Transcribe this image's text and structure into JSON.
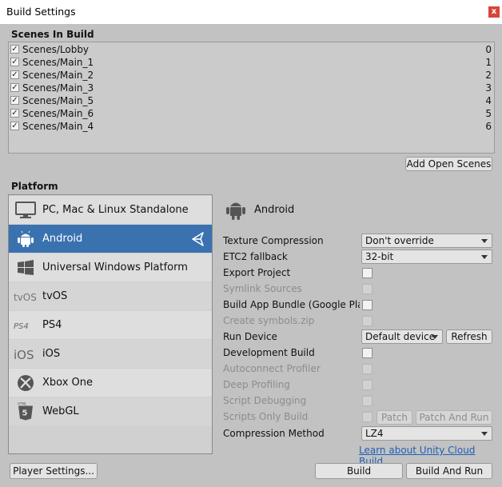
{
  "window": {
    "title": "Build Settings",
    "close_label": "x"
  },
  "scenes": {
    "header": "Scenes In Build",
    "items": [
      {
        "name": "Scenes/Lobby",
        "index": "0",
        "checked": true
      },
      {
        "name": "Scenes/Main_1",
        "index": "1",
        "checked": true
      },
      {
        "name": "Scenes/Main_2",
        "index": "2",
        "checked": true
      },
      {
        "name": "Scenes/Main_3",
        "index": "3",
        "checked": true
      },
      {
        "name": "Scenes/Main_5",
        "index": "4",
        "checked": true
      },
      {
        "name": "Scenes/Main_6",
        "index": "5",
        "checked": true
      },
      {
        "name": "Scenes/Main_4",
        "index": "6",
        "checked": true
      }
    ],
    "add_open_scenes": "Add Open Scenes"
  },
  "platform": {
    "header": "Platform",
    "items": [
      {
        "label": "PC, Mac & Linux Standalone",
        "icon": "monitor-icon"
      },
      {
        "label": "Android",
        "icon": "android-icon",
        "selected": true,
        "active_icon": "unity-logo-icon"
      },
      {
        "label": "Universal Windows Platform",
        "icon": "windows-icon"
      },
      {
        "label": "tvOS",
        "icon": "tvos-icon",
        "icon_text": "tvOS"
      },
      {
        "label": "PS4",
        "icon": "ps4-icon",
        "icon_text": "PS4"
      },
      {
        "label": "iOS",
        "icon": "ios-icon",
        "icon_text": "iOS"
      },
      {
        "label": "Xbox One",
        "icon": "xbox-icon"
      },
      {
        "label": "WebGL",
        "icon": "html5-icon",
        "icon_text": "HTML"
      }
    ]
  },
  "settings": {
    "platform_title": "Android",
    "texture_compression": {
      "label": "Texture Compression",
      "value": "Don't override"
    },
    "etc2_fallback": {
      "label": "ETC2 fallback",
      "value": "32-bit"
    },
    "export_project": {
      "label": "Export Project"
    },
    "symlink_sources": {
      "label": "Symlink Sources"
    },
    "build_app_bundle": {
      "label": "Build App Bundle (Google Play)"
    },
    "create_symbols": {
      "label": "Create symbols.zip"
    },
    "run_device": {
      "label": "Run Device",
      "value": "Default device",
      "refresh": "Refresh"
    },
    "development_build": {
      "label": "Development Build"
    },
    "autoconnect_profiler": {
      "label": "Autoconnect Profiler"
    },
    "deep_profiling": {
      "label": "Deep Profiling"
    },
    "script_debugging": {
      "label": "Script Debugging"
    },
    "scripts_only_build": {
      "label": "Scripts Only Build",
      "patch": "Patch",
      "patch_and_run": "Patch And Run"
    },
    "compression_method": {
      "label": "Compression Method",
      "value": "LZ4"
    },
    "cloud_build_link": "Learn about Unity Cloud Build"
  },
  "footer": {
    "player_settings": "Player Settings...",
    "build": "Build",
    "build_and_run": "Build And Run"
  }
}
